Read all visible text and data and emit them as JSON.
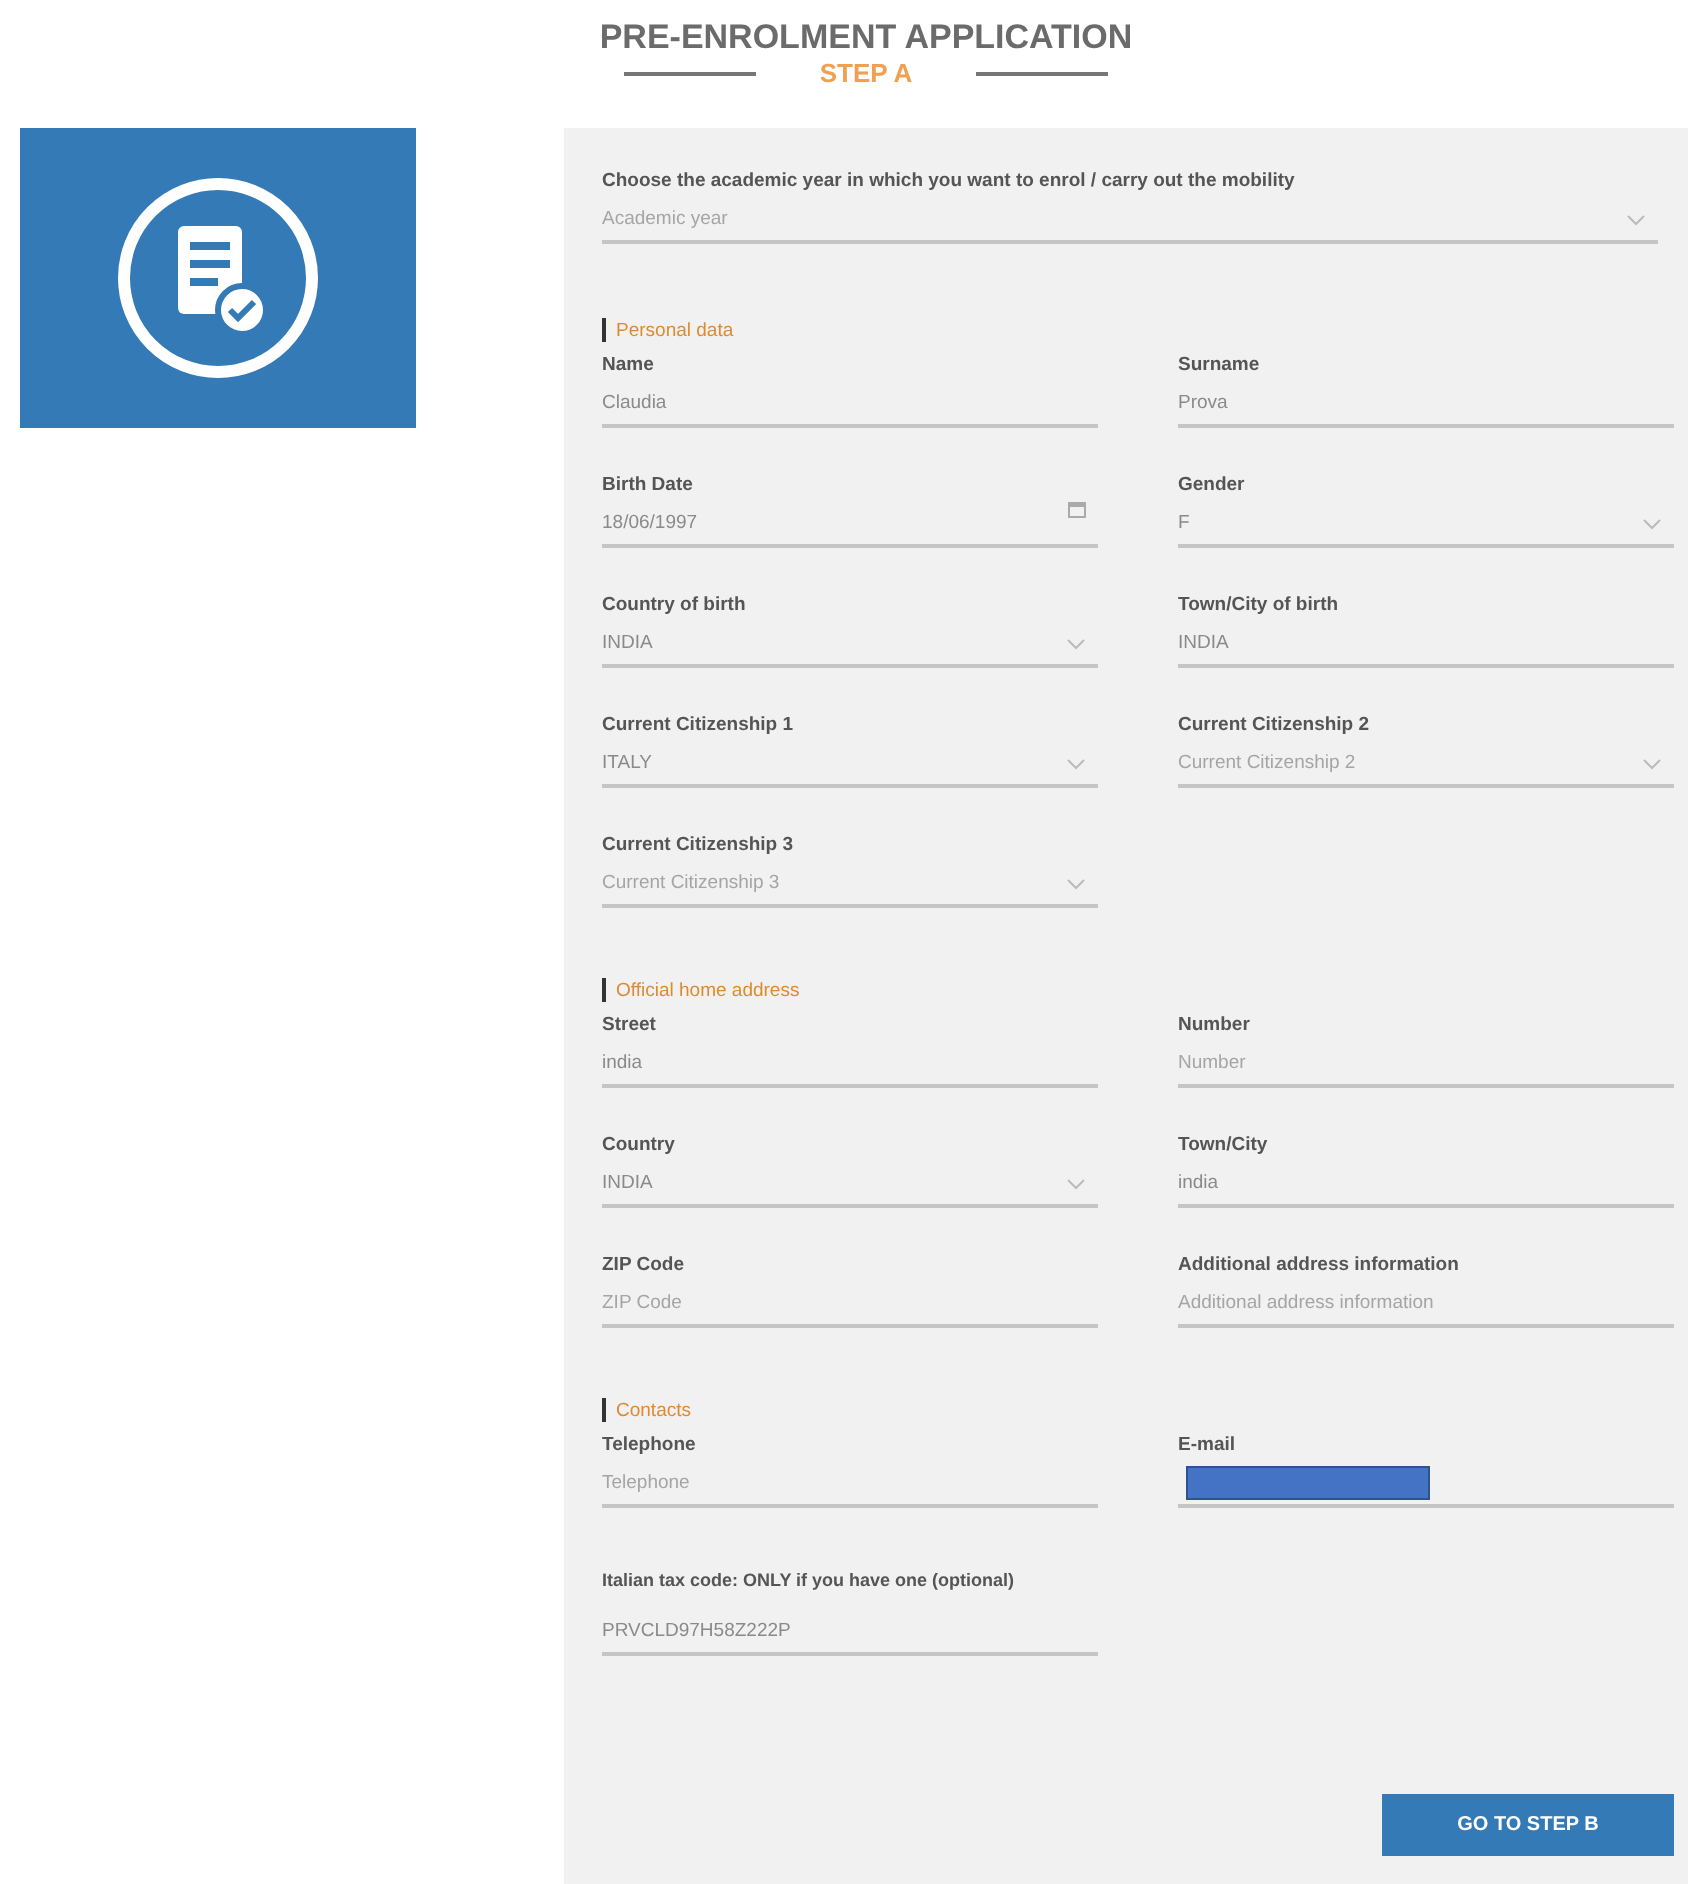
{
  "header": {
    "title": "PRE-ENROLMENT APPLICATION",
    "step": "STEP A"
  },
  "year_field": {
    "label": "Choose the academic year in which you want to enrol / carry out the mobility",
    "kind": "select",
    "placeholder": "Academic year"
  },
  "sections": [
    {
      "title": "Personal data",
      "fields": [
        {
          "label": "Name",
          "kind": "text",
          "value": "Claudia"
        },
        {
          "label": "Surname",
          "kind": "text",
          "value": "Prova"
        },
        {
          "label": "Birth Date",
          "kind": "date",
          "value": "18/06/1997"
        },
        {
          "label": "Gender",
          "kind": "select",
          "value": "F"
        },
        {
          "label": "Country of birth",
          "kind": "select",
          "value": "INDIA"
        },
        {
          "label": "Town/City of birth",
          "kind": "text",
          "value": "INDIA"
        },
        {
          "label": "Current Citizenship 1",
          "kind": "select",
          "value": "ITALY"
        },
        {
          "label": "Current Citizenship 2",
          "kind": "select",
          "placeholder": "Current Citizenship 2"
        },
        {
          "label": "Current Citizenship 3",
          "kind": "select",
          "placeholder": "Current Citizenship 3"
        }
      ]
    },
    {
      "title": "Official home address",
      "fields": [
        {
          "label": "Street",
          "kind": "text",
          "value": "india"
        },
        {
          "label": "Number",
          "kind": "text",
          "placeholder": "Number"
        },
        {
          "label": "Country",
          "kind": "select",
          "value": "INDIA"
        },
        {
          "label": "Town/City",
          "kind": "text",
          "value": "india"
        },
        {
          "label": "ZIP Code",
          "kind": "text",
          "placeholder": "ZIP Code"
        },
        {
          "label": "Additional address information",
          "kind": "text",
          "placeholder": "Additional address information"
        }
      ]
    },
    {
      "title": "Contacts",
      "fields": [
        {
          "label": "Telephone",
          "kind": "text",
          "placeholder": "Telephone"
        },
        {
          "label": "E-mail",
          "kind": "redacted"
        },
        {
          "label": "Italian tax code: ONLY if you have one (optional)",
          "kind": "text",
          "value": "PRVCLD97H58Z222P"
        }
      ]
    }
  ],
  "next_button": "GO TO STEP B"
}
